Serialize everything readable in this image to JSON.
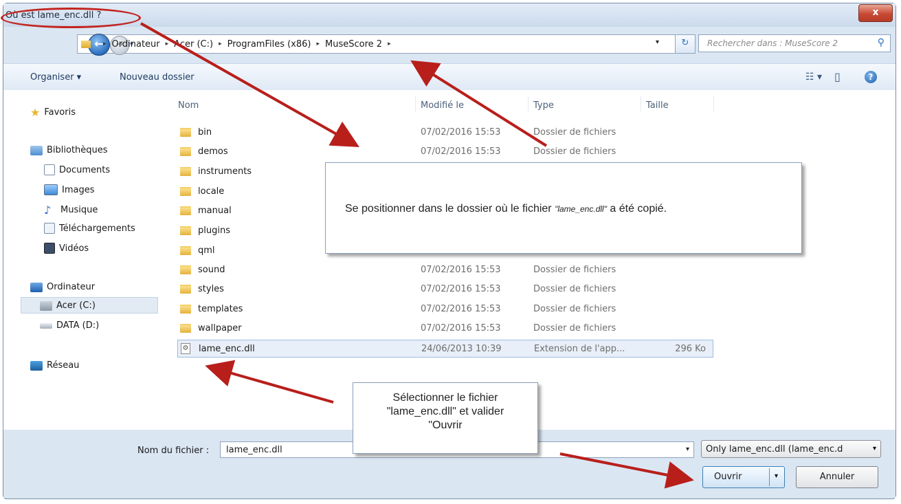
{
  "window": {
    "title": "Où est lame_enc.dll ?",
    "close_glyph": "x"
  },
  "nav": {
    "back_glyph": "←",
    "forward_glyph": "→",
    "history_glyph": "▾",
    "breadcrumbs": [
      "Ordinateur",
      "Acer (C:)",
      "ProgramFiles (x86)",
      "MuseScore 2"
    ],
    "crumb_sep": "▸",
    "addr_dropdown": "▾",
    "refresh_glyph": "↻",
    "search_placeholder": "Rechercher dans : MuseScore 2",
    "search_icon": "search-icon"
  },
  "toolbar": {
    "organize": "Organiser ▾",
    "new_folder": "Nouveau dossier",
    "view_glyph": "☷ ▾",
    "pane_glyph": "▯",
    "help_glyph": "?"
  },
  "sidebar": {
    "favorites": "Favoris",
    "libraries": "Bibliothèques",
    "lib_items": [
      "Documents",
      "Images",
      "Musique",
      "Téléchargements",
      "Vidéos"
    ],
    "computer": "Ordinateur",
    "drives": [
      "Acer (C:)",
      "DATA (D:)"
    ],
    "network": "Réseau"
  },
  "columns": {
    "name": "Nom",
    "modified": "Modifié le",
    "type": "Type",
    "size": "Taille"
  },
  "files": [
    {
      "name": "bin",
      "date": "07/02/2016 15:53",
      "type": "Dossier de fichiers",
      "size": ""
    },
    {
      "name": "demos",
      "date": "07/02/2016 15:53",
      "type": "Dossier de fichiers",
      "size": ""
    },
    {
      "name": "instruments",
      "date": "",
      "type": "",
      "size": ""
    },
    {
      "name": "locale",
      "date": "",
      "type": "",
      "size": ""
    },
    {
      "name": "manual",
      "date": "",
      "type": "",
      "size": ""
    },
    {
      "name": "plugins",
      "date": "",
      "type": "",
      "size": ""
    },
    {
      "name": "qml",
      "date": "",
      "type": "",
      "size": ""
    },
    {
      "name": "sound",
      "date": "07/02/2016 15:53",
      "type": "Dossier de fichiers",
      "size": ""
    },
    {
      "name": "styles",
      "date": "07/02/2016 15:53",
      "type": "Dossier de fichiers",
      "size": ""
    },
    {
      "name": "templates",
      "date": "07/02/2016 15:53",
      "type": "Dossier de fichiers",
      "size": ""
    },
    {
      "name": "wallpaper",
      "date": "07/02/2016 15:53",
      "type": "Dossier de fichiers",
      "size": ""
    },
    {
      "name": "lame_enc.dll",
      "date": "24/06/2013 10:39",
      "type": "Extension de l'app...",
      "size": "296 Ko"
    }
  ],
  "footer": {
    "filename_label": "Nom du fichier :",
    "filename_value": "lame_enc.dll",
    "filter_value": "Only lame_enc.dll (lame_enc.d",
    "open_label": "Ouvrir",
    "cancel_label": "Annuler",
    "dropdown_glyph": "▾"
  },
  "annotations": {
    "callout1_text": "Se positionner dans le dossier où le fichier ",
    "callout1_italic": "\"lame_enc.dll\"",
    "callout1_end": " a été copié.",
    "callout2_line1": "Sélectionner le fichier",
    "callout2_line2": "\"lame_enc.dll\" et valider",
    "callout2_line3": "\"Ouvrir"
  },
  "colors": {
    "accent": "#2b6fc0",
    "arrow": "#b81f1b",
    "selection": "#e8eff8"
  }
}
